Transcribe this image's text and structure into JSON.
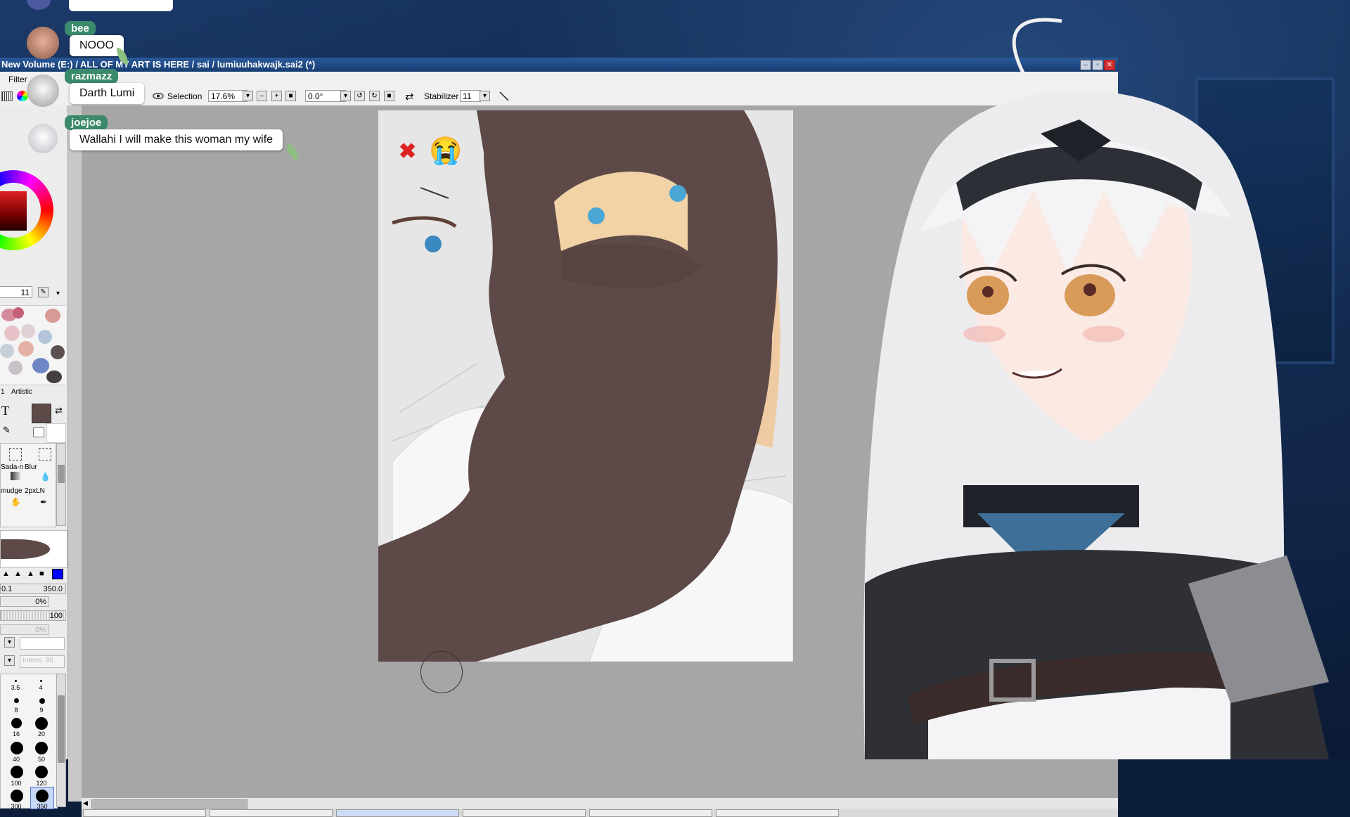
{
  "window": {
    "title": "New Volume (E:) / ALL OF MY ART IS HERE / sai / lumiuuhakwajk.sai2 (*)",
    "minimize_glyph": "–",
    "maximize_glyph": "▫",
    "close_glyph": "✕"
  },
  "menu": {
    "filter": "Filter"
  },
  "toolbar": {
    "selection_label": "Selection",
    "zoom": "17.6%",
    "rotation": "0.0°",
    "stabilizer_label": "Stabilizer",
    "stabilizer_value": "11"
  },
  "left_panel": {
    "color_value": "11",
    "tab_artistic": "Artistic",
    "tab_number": "1",
    "text_tool": "T",
    "tools": {
      "shade": "Sada-n",
      "blur": "Blur",
      "smudge": "mudge",
      "pen": "2pxLN"
    },
    "size_min": "0.1",
    "size_max": "350.0",
    "density": "0%",
    "opacity": "100",
    "blend": "0%",
    "intensity": "Intens. 95",
    "brush_sizes": [
      "3.5",
      "4",
      "8",
      "9",
      "16",
      "20",
      "40",
      "50",
      "100",
      "120",
      "300",
      "350"
    ],
    "selected_brush_size": "350"
  },
  "chat": [
    {
      "user": "bee",
      "message": "NOOO",
      "color": "#3b8a6b"
    },
    {
      "user": "razmazz",
      "message": "Darth Lumi",
      "color": "#3b8a6b"
    },
    {
      "user": "joejoe",
      "message": "Wallahi I will make this woman my wife",
      "color": "#3b8a6b"
    }
  ],
  "canvas": {
    "emojis": [
      "✖",
      "😭"
    ],
    "artboard_bg": "#e6e6e6",
    "paint_color": "#5d4a48"
  },
  "colors": {
    "accent": "#2a5a9a",
    "chat_name": "#3b8a6b",
    "close": "#d32f2f"
  }
}
